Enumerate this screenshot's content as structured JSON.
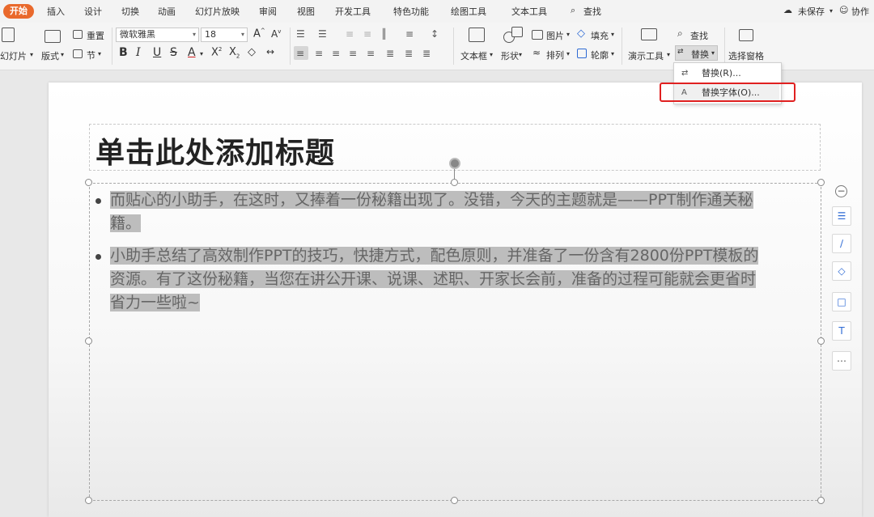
{
  "tabs": {
    "active": "开始",
    "items": [
      "插入",
      "设计",
      "切换",
      "动画",
      "幻灯片放映",
      "审阅",
      "视图",
      "开发工具",
      "特色功能",
      "绘图工具",
      "文本工具"
    ],
    "search": "查找",
    "save_status": "未保存",
    "collab": "协作"
  },
  "ribbon": {
    "new_slide": "幻灯片",
    "layout": "版式",
    "reset": "重置",
    "section": "节",
    "font_name": "微软雅黑",
    "font_size": "18",
    "text_box": "文本框",
    "shape": "形状",
    "picture": "图片",
    "fill": "填充",
    "arrange": "排列",
    "outline": "轮廓",
    "present_tool": "演示工具",
    "find": "查找",
    "replace": "替换",
    "select_pane": "选择窗格"
  },
  "dropdown": {
    "items": [
      {
        "label": "替换(R)...",
        "icon": "replace-icon"
      },
      {
        "label": "替换字体(O)...",
        "icon": "replace-font-icon"
      }
    ],
    "highlight_color": "#e02020"
  },
  "slide": {
    "title": "单击此处添加标题",
    "paragraphs": [
      {
        "line1": "而贴心的小助手，在这时，又捧着一份秘籍出现了。没错，今天的主题就是——PPT制作通关秘",
        "line2": "籍。"
      },
      {
        "line1": "小助手总结了高效制作PPT的技巧，快捷方式，配色原则，并准备了一份含有2800份PPT模板的",
        "line2": "资源。有了这份秘籍，当您在讲公开课、说课、述职、开家长会前，准备的过程可能就会更省时",
        "line3": "省力一些啦~"
      }
    ]
  },
  "colors": {
    "accent": "#e9692c",
    "selection": "#bdbdbd",
    "highlight_box": "#e02020"
  }
}
